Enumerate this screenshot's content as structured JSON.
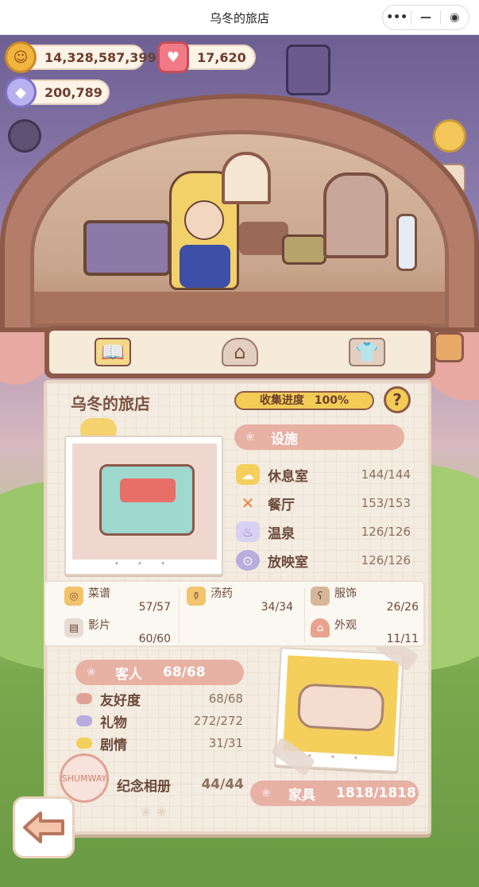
{
  "titlebar": {
    "title": "乌冬的旅店",
    "more_glyph": "•••",
    "minimize_glyph": "—",
    "close_glyph": "◉"
  },
  "currency": {
    "coins": "14,328,587,399",
    "hearts": "17,620",
    "gems": "200,789"
  },
  "tabs": [
    {
      "icon": "book-icon"
    },
    {
      "icon": "mushroom-house-icon"
    },
    {
      "icon": "shirt-icon"
    }
  ],
  "panel": {
    "title": "乌冬的旅店",
    "progress_label": "收集进度",
    "progress_value": "100%",
    "help_label": "?"
  },
  "facilities": {
    "header": "设施",
    "items": [
      {
        "label": "休息室",
        "value": "144/144",
        "icon": "cloud-bed-icon",
        "color": "#f5cf5b"
      },
      {
        "label": "餐厅",
        "value": "153/153",
        "icon": "fork-knife-icon",
        "color": "#e8833d"
      },
      {
        "label": "温泉",
        "value": "126/126",
        "icon": "hot-spring-icon",
        "color": "#b7aede"
      },
      {
        "label": "放映室",
        "value": "126/126",
        "icon": "film-reel-icon",
        "color": "#aa9ad6"
      }
    ]
  },
  "collections": [
    {
      "label": "菜谱",
      "value": "57/57",
      "icon": "pancake-icon"
    },
    {
      "label": "汤药",
      "value": "34/34",
      "icon": "potion-jar-icon"
    },
    {
      "label": "服饰",
      "value": "26/26",
      "icon": "bear-costume-icon"
    },
    {
      "label": "影片",
      "value": "60/60",
      "icon": "clapper-icon"
    },
    {
      "label": "外观",
      "value": "11/11",
      "icon": "mushroom-icon"
    }
  ],
  "guests": {
    "header": "客人",
    "value": "68/68",
    "items": [
      {
        "label": "友好度",
        "value": "68/68",
        "color": "#e0a294"
      },
      {
        "label": "礼物",
        "value": "272/272",
        "color": "#b8acdf"
      },
      {
        "label": "剧情",
        "value": "31/31",
        "color": "#f5cf5b"
      }
    ]
  },
  "album": {
    "label": "纪念相册",
    "value": "44/44",
    "stamp_text": "SHUMWAY"
  },
  "furniture": {
    "label": "家具",
    "value": "1818/1818"
  },
  "carousel_dots": "• • •"
}
